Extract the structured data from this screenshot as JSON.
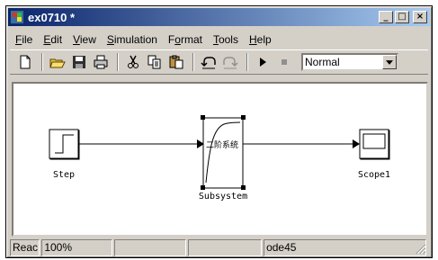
{
  "window": {
    "title": "ex0710 *",
    "controls": {
      "minimize": "_",
      "maximize": "□",
      "close": "×"
    }
  },
  "menu": [
    {
      "label": "File",
      "accel": "F",
      "rest": "ile"
    },
    {
      "label": "Edit",
      "accel": "E",
      "rest": "dit"
    },
    {
      "label": "View",
      "accel": "V",
      "rest": "iew"
    },
    {
      "label": "Simulation",
      "accel": "S",
      "rest": "imulation"
    },
    {
      "label": "Format",
      "pre": "F",
      "accel": "o",
      "rest": "rmat"
    },
    {
      "label": "Tools",
      "accel": "T",
      "rest": "ools"
    },
    {
      "label": "Help",
      "accel": "H",
      "rest": "elp"
    }
  ],
  "toolbar": {
    "icons": [
      "new-icon",
      "open-icon",
      "save-icon",
      "print-icon",
      "cut-icon",
      "copy-icon",
      "paste-icon",
      "undo-icon",
      "redo-icon",
      "start-icon",
      "stop-icon"
    ],
    "sim_mode": "Normal"
  },
  "diagram": {
    "blocks": [
      {
        "name": "Step"
      },
      {
        "name": "Subsystem",
        "inner_text": "二阶系统"
      },
      {
        "name": "Scope1"
      }
    ]
  },
  "status": {
    "ready": "Reac",
    "zoom": "100%",
    "empty1": "",
    "empty2": "",
    "solver": "ode45"
  },
  "colors": {
    "titlebar_start": "#0a246a",
    "titlebar_end": "#a6caf0",
    "face": "#d4d0c8"
  }
}
